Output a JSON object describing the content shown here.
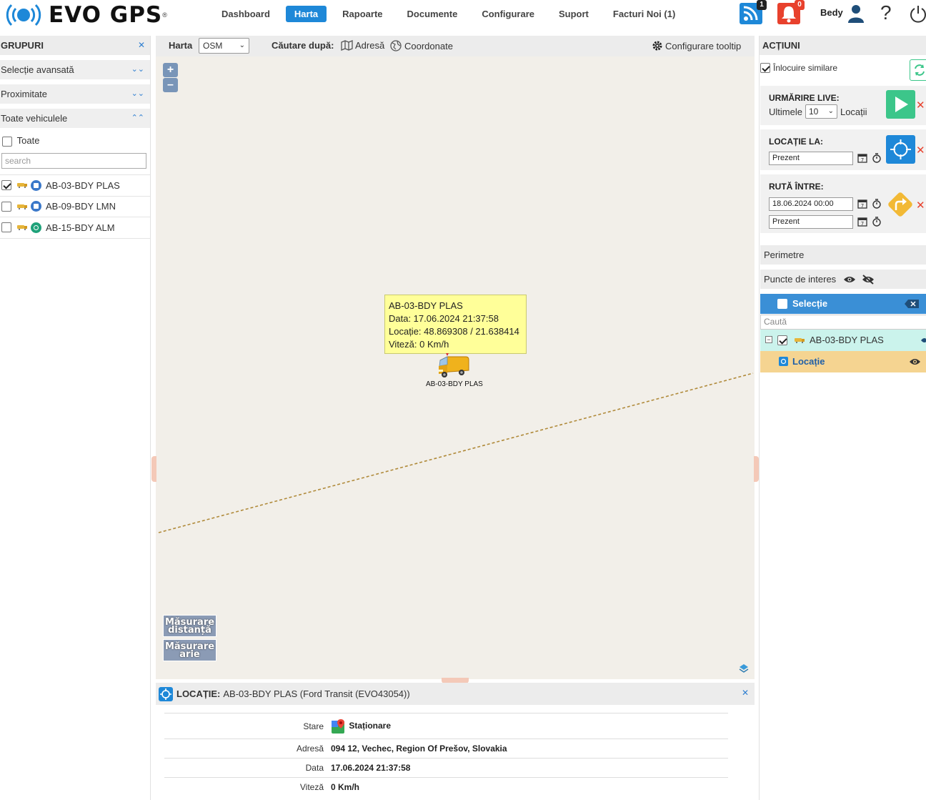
{
  "header": {
    "brand": "EVO GPS",
    "nav": [
      "Dashboard",
      "Harta",
      "Rapoarte",
      "Documente",
      "Configurare",
      "Suport",
      "Facturi Noi (1)"
    ],
    "rss_badge": "1",
    "alerts_badge": "0",
    "user": "Bedy",
    "help": "?"
  },
  "left": {
    "title": "GRUPURI",
    "sections": [
      "Selecție avansată",
      "Proximitate",
      "Toate vehiculele"
    ],
    "all_label": "Toate",
    "search_placeholder": "search",
    "vehicles": [
      {
        "name": "AB-03-BDY PLAS",
        "checked": true,
        "state": "blue"
      },
      {
        "name": "AB-09-BDY LMN",
        "checked": false,
        "state": "blue"
      },
      {
        "name": "AB-15-BDY ALM",
        "checked": false,
        "state": "green"
      }
    ]
  },
  "map": {
    "map_label": "Harta",
    "layer": "OSM",
    "search_label": "Căutare după:",
    "address_link": "Adresă",
    "coords_link": "Coordonate",
    "tooltip_config": "Configurare tooltip",
    "zoom_in": "+",
    "zoom_out": "–",
    "measure_distance_1": "Măsurare",
    "measure_distance_2": "distanță",
    "measure_area_1": "Măsurare",
    "measure_area_2": "arie",
    "tooltip": {
      "name": "AB-03-BDY PLAS",
      "date": "Data: 17.06.2024 21:37:58",
      "location": "Locație: 48.869308 / 21.638414",
      "speed": "Viteză: 0 Km/h"
    },
    "vehicle_label": "AB-03-BDY PLAS"
  },
  "location_panel": {
    "title_bold": "LOCAȚIE:",
    "title_rest": "AB-03-BDY PLAS (Ford Transit (EVO43054))",
    "rows": [
      {
        "key": "Stare",
        "value": "Staționare"
      },
      {
        "key": "Adresă",
        "value": "094 12, Vechec, Region Of Prešov, Slovakia"
      },
      {
        "key": "Data",
        "value": "17.06.2024 21:37:58"
      },
      {
        "key": "Viteză",
        "value": "0 Km/h"
      }
    ]
  },
  "right": {
    "title": "ACȚIUNI",
    "replace_similar": "Înlocuire similare",
    "live": {
      "title": "URMĂRIRE LIVE:",
      "prefix": "Ultimele",
      "count": "10",
      "suffix": "Locații"
    },
    "location_at": {
      "title": "LOCAȚIE LA:",
      "value": "Prezent"
    },
    "route": {
      "title": "RUTĂ ÎNTRE:",
      "from": "18.06.2024 00:00",
      "to": "Prezent"
    },
    "perimeters": "Perimetre",
    "poi": "Puncte de interes",
    "selection": "Selecție",
    "search_placeholder": "Caută",
    "tree_vehicle": "AB-03-BDY PLAS",
    "tree_location": "Locație"
  },
  "colors": {
    "accent": "#1e88d8",
    "play": "#3cc68a",
    "route": "#f2b935",
    "danger": "#e8412d"
  }
}
